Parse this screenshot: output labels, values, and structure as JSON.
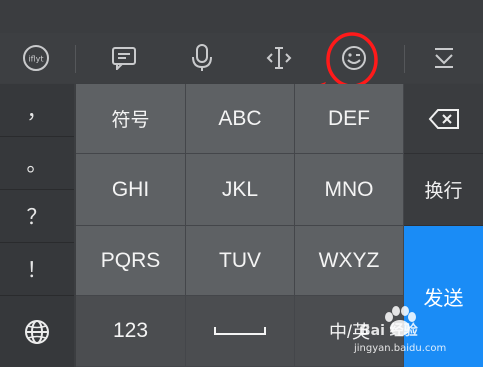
{
  "toolbar": {
    "logo_text": "iflyt",
    "icons": [
      "logo-icon",
      "keyboard-handwrite-icon",
      "microphone-icon",
      "cursor-icon",
      "emoji-icon",
      "collapse-keyboard-icon"
    ]
  },
  "punctuation": [
    "，",
    "。",
    "？",
    "！"
  ],
  "keys": {
    "row1": [
      "符号",
      "ABC",
      "DEF"
    ],
    "row2": [
      "GHI",
      "JKL",
      "MNO"
    ],
    "row3": [
      "PQRS",
      "TUV",
      "WXYZ"
    ],
    "row4": [
      "123",
      "",
      "中/英"
    ]
  },
  "side": {
    "newline_label": "换行",
    "send_label": "发送"
  },
  "annotation": {
    "color": "#ff1a1a"
  },
  "watermark": {
    "brand": "Bai 经验",
    "url": "jingyan.baidu.com"
  },
  "colors": {
    "accent": "#1a8cf6",
    "key": "#5e6164",
    "background": "#3c3e41"
  }
}
